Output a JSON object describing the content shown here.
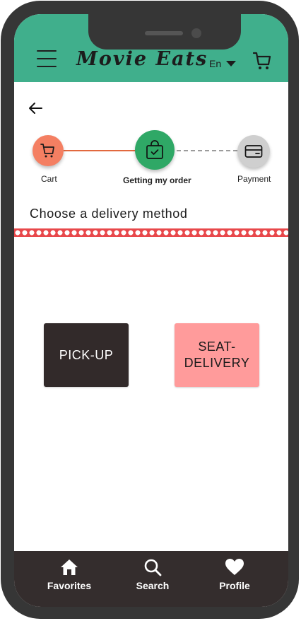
{
  "app": {
    "title": "Movie Eats",
    "language": "En",
    "accent_color": "#40af8c"
  },
  "header": {
    "menu_icon": "hamburger-menu-icon",
    "cart_icon": "cart-icon",
    "back_icon": "back-arrow-icon"
  },
  "stepper": {
    "steps": [
      {
        "label": "Cart",
        "icon": "cart-icon",
        "state": "done",
        "color": "#f47f62"
      },
      {
        "label": "Getting my order",
        "icon": "shopping-bag-check-icon",
        "state": "current",
        "color": "#2fa866"
      },
      {
        "label": "Payment",
        "icon": "credit-card-icon",
        "state": "upcoming",
        "color": "#cfcfcf"
      }
    ]
  },
  "main": {
    "section_title": "Choose a delivery method",
    "options": [
      {
        "label": "PICK-UP",
        "color": "#322a2a"
      },
      {
        "label": "SEAT-\nDELIVERY",
        "color": "#ff9b9b"
      }
    ]
  },
  "bottom_nav": {
    "items": [
      {
        "label": "Favorites",
        "icon": "home-icon"
      },
      {
        "label": "Search",
        "icon": "search-icon"
      },
      {
        "label": "Profile",
        "icon": "heart-icon"
      }
    ]
  }
}
